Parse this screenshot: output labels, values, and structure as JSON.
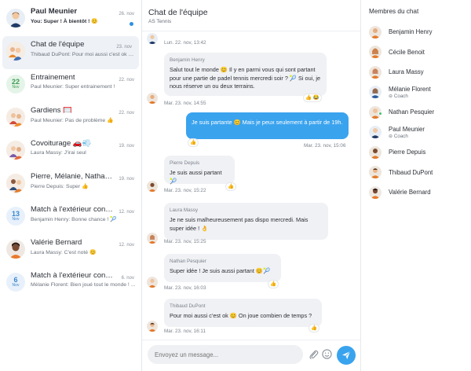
{
  "conversations": [
    {
      "name": "Paul Meunier",
      "preview": "You: Super ! À bientôt ! 😊",
      "date": "26. nov",
      "unread": true,
      "avatar": "person"
    },
    {
      "name": "Chat de l'équipe",
      "preview": "Thibaud DuPont: Pour moi aussi c'est ok 😊 ...",
      "date": "23. nov",
      "active": true,
      "avatar": "group"
    },
    {
      "name": "Entrainement",
      "preview": "Paul Meunier: Super entrainement !",
      "date": "22. nov",
      "avatar": "date",
      "day": "22",
      "month": "Nov",
      "green": true
    },
    {
      "name": "Gardiens 🥅",
      "preview": "Paul Meunier: Pas de problème 👍",
      "date": "22. nov",
      "avatar": "group"
    },
    {
      "name": "Covoiturage 🚗💨",
      "preview": "Laura Massy: J'irai seul",
      "date": "19. nov",
      "avatar": "group"
    },
    {
      "name": "Pierre, Mélanie, Nathan, B...",
      "preview": "Pierre Depuis: Super 👍",
      "date": "19. nov",
      "avatar": "group"
    },
    {
      "name": "Match à l'extérieur contre ...",
      "preview": "Benjamin Henry: Bonne chance ! 🎾",
      "date": "12. nov",
      "avatar": "date",
      "day": "13",
      "month": "Nov"
    },
    {
      "name": "Valérie Bernard",
      "preview": "Laura Massy: C'est noté 😊",
      "date": "12. nov",
      "avatar": "person"
    },
    {
      "name": "Match à l'extérieur contre ...",
      "preview": "Mélanie Florent: Bien joué tout le monde ! ...",
      "date": "6. nov",
      "avatar": "date",
      "day": "6",
      "month": "Nov"
    }
  ],
  "chat": {
    "title": "Chat de l'équipe",
    "subtitle": "AS Tennis",
    "messages": [
      {
        "meta": "Lun. 22. nov, 13:42"
      },
      {
        "author": "Benjamin Henry",
        "text": "Salut tout le monde 😊 Il y en parmi vous qui sont partant pour une partie de padel tennis mercredi soir ? 🎾 Si oui, je nous réserve un ou deux terrains.",
        "meta": "Mar. 23. nov, 14:55",
        "reactions": "👍 😂"
      },
      {
        "author": "",
        "text": "Je suis partante 😊 Mais je peux seulement à partir de 19h.",
        "meta": "Mar. 23. nov, 15:06",
        "reactions": "👍",
        "me": true
      },
      {
        "author": "Pierre Depuis",
        "text": "Je suis aussi partant 🎾",
        "meta": "Mar. 23. nov, 15:22",
        "reactions": "👍"
      },
      {
        "author": "Laura Massy",
        "text": "Je ne suis malheureusement pas dispo mercredi. Mais super idée ! 👌",
        "meta": "Mar. 23. nov, 15:25"
      },
      {
        "author": "Nathan Pesquier",
        "text": "Super idée ! Je suis aussi partant 😊🎾",
        "meta": "Mar. 23. nov, 16:03",
        "reactions": "👍"
      },
      {
        "author": "Thibaud DuPont",
        "text": "Pour moi aussi c'est ok 😊 On joue combien de temps ?",
        "meta": "Mar. 23. nov, 16:11",
        "reactions": "👍"
      }
    ]
  },
  "composer": {
    "placeholder": "Envoyez un message..."
  },
  "members": {
    "title": "Membres du chat",
    "list": [
      {
        "name": "Benjamin Henry",
        "role": ""
      },
      {
        "name": "Cécile Benoit",
        "role": ""
      },
      {
        "name": "Laura Massy",
        "role": ""
      },
      {
        "name": "Mélanie Florent",
        "role": "Coach"
      },
      {
        "name": "Nathan Pesquier",
        "role": "",
        "online": true
      },
      {
        "name": "Paul Meunier",
        "role": "Coach"
      },
      {
        "name": "Pierre Depuis",
        "role": ""
      },
      {
        "name": "Thibaud DuPont",
        "role": ""
      },
      {
        "name": "Valérie Bernard",
        "role": ""
      }
    ]
  },
  "colors": {
    "accent": "#3aa3ee",
    "unread_dot": "#2d8fe0",
    "online": "#3fbf6a"
  }
}
